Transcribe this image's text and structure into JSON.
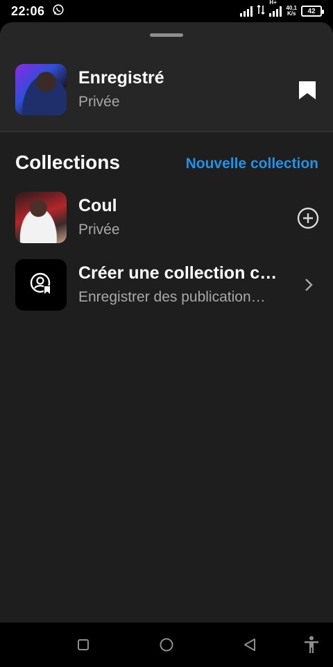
{
  "status_bar": {
    "time": "22:06",
    "network_type": "H+",
    "speed_value": "40,1",
    "speed_unit": "K/s",
    "battery": "42"
  },
  "saved": {
    "title": "Enregistré",
    "subtitle": "Privée"
  },
  "collections_header": {
    "title": "Collections",
    "new_collection_label": "Nouvelle collection"
  },
  "collections": [
    {
      "title": "Coul",
      "subtitle": "Privée"
    },
    {
      "title": "Créer une collection c…",
      "subtitle": "Enregistrer des publication…"
    }
  ],
  "colors": {
    "accent": "#1f93e8",
    "sheet_top": "#262626",
    "sheet_body": "#1e1e1e"
  },
  "icons": {
    "whatsapp": "whatsapp-icon",
    "bookmark": "bookmark-icon",
    "add": "add-circle-icon",
    "chevron": "chevron-right-icon",
    "create_collection": "person-bookmark-icon",
    "nav_recent": "square-icon",
    "nav_home": "circle-icon",
    "nav_back": "triangle-back-icon",
    "accessibility": "accessibility-icon"
  }
}
